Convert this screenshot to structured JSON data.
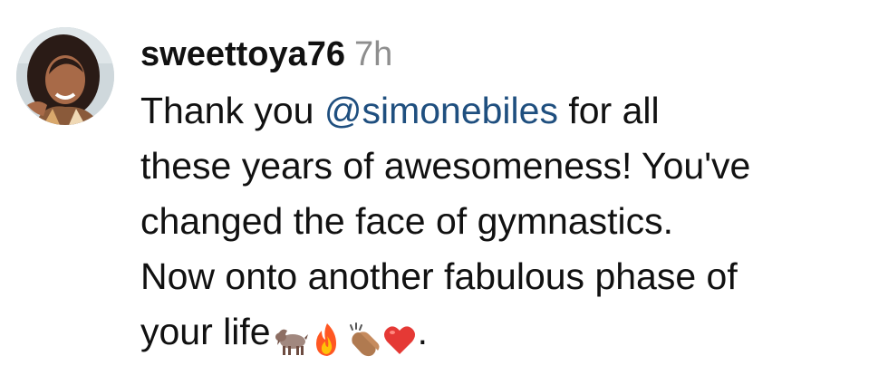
{
  "comment": {
    "username": "sweettoya76",
    "time": "7h",
    "text": {
      "line1_before": "Thank you ",
      "mention": "@simonebiles",
      "line1_after": " for all",
      "line2": "these years of awesomeness! You've",
      "line3": "changed the face of gymnastics.",
      "line4": "Now onto another fabulous phase of",
      "line5_before": "your life",
      "line5_after": "."
    },
    "emojis": [
      "goat-emoji",
      "fire-emoji",
      "clapping-hands-emoji",
      "red-heart-emoji"
    ]
  },
  "colors": {
    "mention": "#1f4f7f",
    "time": "#8e8e8e",
    "text": "#111111"
  }
}
